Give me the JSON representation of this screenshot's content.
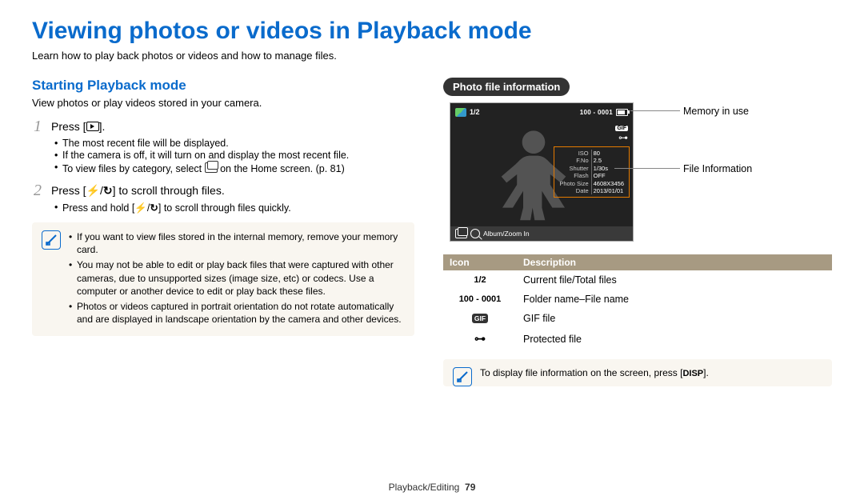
{
  "title": "Viewing photos or videos in Playback mode",
  "intro": "Learn how to play back photos or videos and how to manage files.",
  "left": {
    "heading": "Starting Playback mode",
    "sub": "View photos or play videos stored in your camera.",
    "step1_pre": "Press [",
    "step1_post": "].",
    "step1_b1": "The most recent file will be displayed.",
    "step1_b2": "If the camera is off, it will turn on and display the most recent file.",
    "step1_b3_a": "To view files by category, select ",
    "step1_b3_b": " on the Home screen. (p. 81)",
    "step2_pre": "Press [",
    "step2_mid": "/",
    "step2_post": "] to scroll through files.",
    "step2_b1_pre": "Press and hold [",
    "step2_b1_mid": "/",
    "step2_b1_post": "] to scroll through files quickly.",
    "note1": "If you want to view files stored in the internal memory, remove your memory card.",
    "note2": "You may not be able to edit or play back files that were captured with other cameras, due to unsupported sizes (image size, etc) or codecs. Use a computer or another device to edit or play back these files.",
    "note3": "Photos or videos captured in portrait orientation do not rotate automatically and are displayed in landscape orientation by the camera and other devices."
  },
  "right": {
    "pill": "Photo file information",
    "lcd": {
      "counter": "1/2",
      "folder": "100 - 0001",
      "gif": "GIF",
      "info_rows": [
        [
          "ISO",
          "80"
        ],
        [
          "F.No",
          "2.5"
        ],
        [
          "Shutter",
          "1/30s"
        ],
        [
          "Flash",
          "OFF"
        ],
        [
          "Photo Size",
          "4608X3456"
        ],
        [
          "Date",
          "2013/01/01"
        ]
      ],
      "bottom": "Album/Zoom In"
    },
    "callout1": "Memory in use",
    "callout2": "File Information",
    "th_icon": "Icon",
    "th_desc": "Description",
    "rows": [
      {
        "icon": "1/2",
        "text": "Current file/Total files"
      },
      {
        "icon": "100 - 0001",
        "text": "Folder name–File name"
      },
      {
        "icon": "GIF",
        "text": "GIF file"
      },
      {
        "icon": "KEY",
        "text": "Protected file"
      }
    ],
    "tip_pre": "To display file information on the screen, press [",
    "tip_disp": "DISP",
    "tip_post": "]."
  },
  "footer_section": "Playback/Editing",
  "footer_page": "79"
}
